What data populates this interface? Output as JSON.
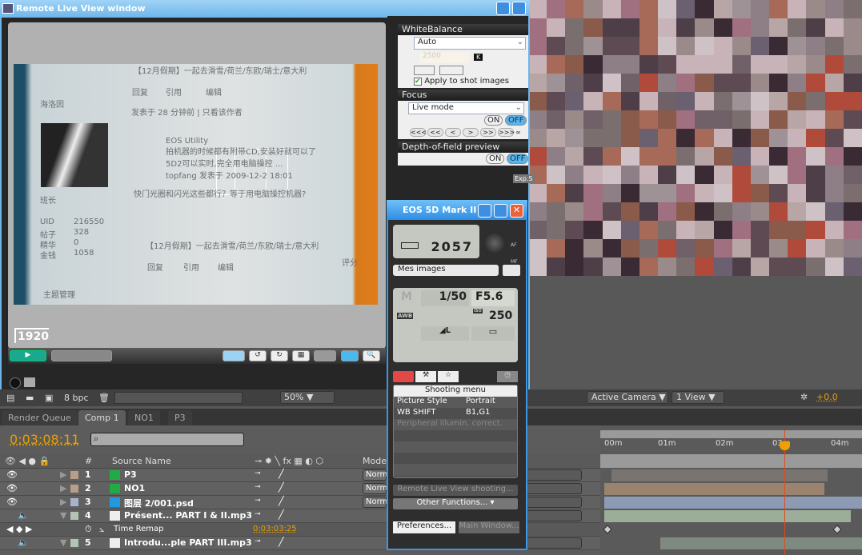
{
  "live_view": {
    "title": "Remote Live View window",
    "resolution_badge": "1920",
    "photo_text": [
      "【12月假期】一起去滑雪/荷兰/东欧/瑞士/意大利",
      "回复",
      "引用",
      "编辑",
      "海洛因",
      "发表于 28 分钟前 | 只看该作者",
      "EOS Utility",
      "拍机器的时候都有附带CD,安装好就可以了",
      "5D2可以实时,完全用电脑操控 ...",
      "topfang 发表于 2009-12-2 18:01",
      "快门光圈和闪光这些都行？等于用电脑操控机器?",
      "班长",
      "UID",
      "216550",
      "帖子",
      "328",
      "精华",
      "0",
      "金钱",
      "1058",
      "【12月假期】一起去滑雪/荷兰/东欧/瑞士/意大利",
      "回复",
      "引用",
      "编辑",
      "主题管理",
      "评分"
    ]
  },
  "settings": {
    "white_balance": {
      "header": "WhiteBalance",
      "mode": "Auto",
      "kelvin": "2500",
      "kelvin_unit": "K",
      "apply_label": "Apply to shot images",
      "apply_checked": true
    },
    "focus": {
      "header": "Focus",
      "mode": "Live mode",
      "on": "ON",
      "off": "OFF",
      "steps": [
        "<<<",
        "<<",
        "<",
        ">",
        ">>",
        ">>>"
      ],
      "infinity": "∞"
    },
    "dof": {
      "header": "Depth-of-field preview",
      "on": "ON",
      "off": "OFF"
    },
    "exp_sim": "Exp.S"
  },
  "eos": {
    "title": "EOS 5D Mark II",
    "shots_remaining": "2057",
    "folder": "Mes images",
    "mode": "M",
    "shutter": "1/50",
    "aperture": "F5.6",
    "wb": "AWB",
    "iso_label": "ISO",
    "iso": "250",
    "quality": "◢L",
    "af": "AF",
    "mf": "MF",
    "menu_title": "Shooting menu",
    "menu": [
      {
        "k": "Picture Style",
        "v": "Portrait"
      },
      {
        "k": "WB SHIFT",
        "v": "B1,G1"
      },
      {
        "k": "Peripheral illumin. correct.",
        "v": ""
      }
    ],
    "remote_btn": "Remote Live View shooting...",
    "other_btn": "Other Functions...",
    "prefs_btn": "Preferences...",
    "main_btn": "Main Window..."
  },
  "ae": {
    "bpc": "8 bpc",
    "zoom": "50%",
    "camera": "Active Camera",
    "views": "1 View",
    "exposure": "+0.0",
    "tabs": [
      "Render Queue",
      "Comp 1",
      "NO1",
      "P3"
    ],
    "timecode": "0:03:08:11",
    "columns": {
      "num": "#",
      "source": "Source Name",
      "mode": "Mode"
    },
    "layers": [
      {
        "n": "1",
        "name": "P3",
        "mode": "Norm",
        "color": "#b89e88"
      },
      {
        "n": "2",
        "name": "NO1",
        "mode": "Norm",
        "color": "#b89e88"
      },
      {
        "n": "3",
        "name": "图层 2/001.psd",
        "mode": "Norm",
        "color": "#a9b4cc"
      },
      {
        "n": "4",
        "name": "Présent... PART I & II.mp3",
        "mode": "",
        "color": "#b4c4b4"
      },
      {
        "n": "5",
        "name": "Introdu...ple PART III.mp3",
        "mode": "",
        "color": "#b4c4b4"
      }
    ],
    "time_remap": {
      "label": "Time Remap",
      "value": "0:03:03:25"
    },
    "ruler": [
      "00m",
      "01m",
      "02m",
      "03m",
      "04m"
    ]
  },
  "colors": {
    "accent": "#e8a000",
    "playhead": "#e04a1a",
    "win_blue": "#3d95e6"
  }
}
